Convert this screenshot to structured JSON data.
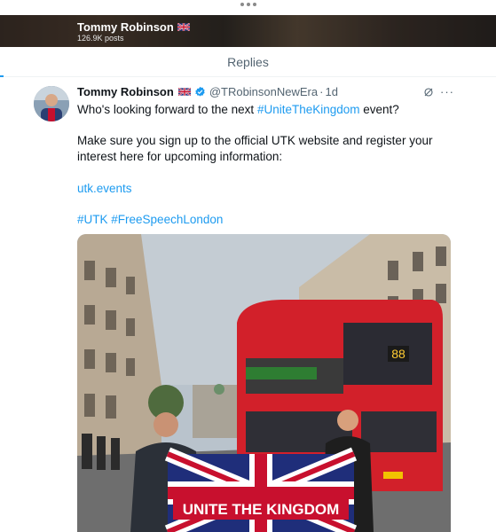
{
  "top_bar": {
    "handle_icon": "more-dots-icon"
  },
  "profile_banner": {
    "name": "Tommy Robinson",
    "flag": "uk-flag-icon",
    "posts": "126.9K posts"
  },
  "replies_tab": {
    "label": "Replies"
  },
  "tweet": {
    "author_name": "Tommy Robinson",
    "flag": "uk-flag-icon",
    "verified": "verified-badge-icon",
    "handle": "@TRobinsonNewEra",
    "separator": "·",
    "time": "1d",
    "line1_prefix": "Who's looking forward to the next ",
    "line1_hashtag": "#UniteTheKingdom",
    "line1_suffix": " event?",
    "paragraph2_line1": "Make sure you sign up to the official UTK website and register your",
    "paragraph2_line2": "interest here for upcoming information:",
    "link": "utk.events",
    "hashtag1": "#UTK",
    "hashtag2": "#FreeSpeechLondon",
    "grok_icon": "grok-icon",
    "more_icon": "more-horizontal-icon",
    "more_text": "···"
  },
  "media": {
    "flag_banner_text": "UNITE THE KINGDOM",
    "bus_route": "88",
    "colors": {
      "bus_red": "#d2202a",
      "flag_blue": "#1f2e7a",
      "sky": "#b9c3cc"
    }
  },
  "colors": {
    "accent": "#1d9bf0",
    "secondary_text": "#536471",
    "primary_text": "#0f1419"
  }
}
